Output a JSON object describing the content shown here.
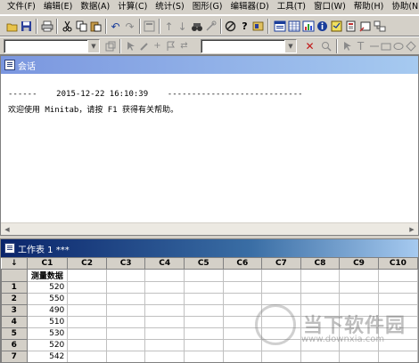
{
  "menu": {
    "items": [
      "文件(F)",
      "编辑(E)",
      "数据(A)",
      "计算(C)",
      "统计(S)",
      "图形(G)",
      "编辑器(D)",
      "工具(T)",
      "窗口(W)",
      "帮助(H)",
      "协助(N)"
    ]
  },
  "session": {
    "title": "会话",
    "line1": "------    2015-12-22 16:10:39    ----------------------------",
    "line2": "欢迎使用 Minitab，请按 F1 获得有关帮助。"
  },
  "worksheet": {
    "title": "工作表 1 ***",
    "corner_symbol": "↓",
    "columns": [
      "C1",
      "C2",
      "C3",
      "C4",
      "C5",
      "C6",
      "C7",
      "C8",
      "C9",
      "C10"
    ],
    "column_names": [
      "测量数据",
      "",
      "",
      "",
      "",
      "",
      "",
      "",
      "",
      ""
    ],
    "rows": [
      {
        "index": "1",
        "value": "520"
      },
      {
        "index": "2",
        "value": "550"
      },
      {
        "index": "3",
        "value": "490"
      },
      {
        "index": "4",
        "value": "510"
      },
      {
        "index": "5",
        "value": "530"
      },
      {
        "index": "6",
        "value": "520"
      },
      {
        "index": "7",
        "value": "542"
      }
    ]
  },
  "watermark": {
    "text": "当下软件园",
    "url": "www.downxia.com"
  },
  "icons": {
    "toolbar1": [
      "open-folder-icon",
      "save-icon",
      "print-icon",
      "cut-icon",
      "copy-icon",
      "paste-icon",
      "undo-icon",
      "redo-icon",
      "edit-last-dialog-icon",
      "previous-icon",
      "next-icon",
      "find-icon",
      "replace-icon",
      "cancel-icon",
      "help-icon",
      "stat-guide-icon",
      "session-window-icon",
      "worksheet-icon",
      "graph-icon",
      "info-icon",
      "history-icon",
      "report-pad-icon",
      "close-graph-icon",
      "manage-graphs-icon"
    ],
    "toolbar2": [
      "brush-icon",
      "pencil-icon",
      "crosshair-icon",
      "flag-icon",
      "swap-icon",
      "delete-icon",
      "zoom-icon",
      "select-icon",
      "text-icon",
      "line-icon",
      "rectangle-icon",
      "ellipse-icon",
      "diamond-icon"
    ]
  }
}
